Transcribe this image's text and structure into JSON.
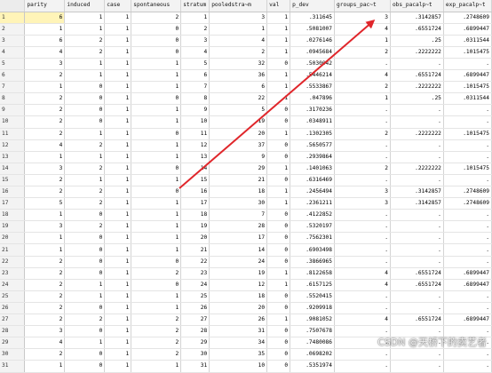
{
  "columns": [
    "",
    "parity",
    "induced",
    "case",
    "spontaneous",
    "stratum",
    "pooledstra~m",
    "val",
    "p_dev",
    "groups_pac~t",
    "obs_pacalp~t",
    "exp_pacalp~t"
  ],
  "rows": [
    [
      "1",
      "6",
      "1",
      "1",
      "2",
      "1",
      "3",
      "1",
      ".311645",
      "3",
      ".3142857",
      ".2748609"
    ],
    [
      "2",
      "1",
      "1",
      "1",
      "0",
      "2",
      "1",
      "1",
      ".5081007",
      "4",
      ".6551724",
      ".6899447"
    ],
    [
      "3",
      "6",
      "2",
      "1",
      "0",
      "3",
      "4",
      "1",
      ".0276146",
      "1",
      ".25",
      ".0311544"
    ],
    [
      "4",
      "4",
      "2",
      "1",
      "0",
      "4",
      "2",
      "1",
      ".0945684",
      "2",
      ".2222222",
      ".1015475"
    ],
    [
      "5",
      "3",
      "1",
      "1",
      "1",
      "5",
      "32",
      "0",
      ".5030042",
      ".",
      ".",
      "."
    ],
    [
      "6",
      "2",
      "1",
      "1",
      "1",
      "6",
      "36",
      "1",
      ".5446214",
      "4",
      ".6551724",
      ".6899447"
    ],
    [
      "7",
      "1",
      "0",
      "1",
      "1",
      "7",
      "6",
      "1",
      ".5533867",
      "2",
      ".2222222",
      ".1015475"
    ],
    [
      "8",
      "2",
      "0",
      "1",
      "0",
      "8",
      "22",
      "1",
      ".047896",
      "1",
      ".25",
      ".0311544"
    ],
    [
      "9",
      "2",
      "0",
      "1",
      "1",
      "9",
      "5",
      "0",
      ".3170236",
      ".",
      ".",
      "."
    ],
    [
      "10",
      "2",
      "0",
      "1",
      "1",
      "10",
      "19",
      "0",
      ".0348911",
      ".",
      ".",
      "."
    ],
    [
      "11",
      "2",
      "1",
      "1",
      "0",
      "11",
      "20",
      "1",
      ".1302305",
      "2",
      ".2222222",
      ".1015475"
    ],
    [
      "12",
      "4",
      "2",
      "1",
      "1",
      "12",
      "37",
      "0",
      ".5650577",
      ".",
      ".",
      "."
    ],
    [
      "13",
      "1",
      "1",
      "1",
      "1",
      "13",
      "9",
      "0",
      ".2939864",
      ".",
      ".",
      "."
    ],
    [
      "14",
      "3",
      "2",
      "1",
      "0",
      "14",
      "29",
      "1",
      ".1401063",
      "2",
      ".2222222",
      ".1015475"
    ],
    [
      "15",
      "2",
      "1",
      "1",
      "1",
      "15",
      "21",
      "0",
      ".6316469",
      ".",
      ".",
      "."
    ],
    [
      "16",
      "2",
      "2",
      "1",
      "0",
      "16",
      "18",
      "1",
      ".2456494",
      "3",
      ".3142857",
      ".2748609"
    ],
    [
      "17",
      "5",
      "2",
      "1",
      "1",
      "17",
      "30",
      "1",
      ".2361211",
      "3",
      ".3142857",
      ".2748609"
    ],
    [
      "18",
      "1",
      "0",
      "1",
      "1",
      "18",
      "7",
      "0",
      ".4122852",
      ".",
      ".",
      "."
    ],
    [
      "19",
      "3",
      "2",
      "1",
      "1",
      "19",
      "28",
      "0",
      ".5320197",
      ".",
      ".",
      "."
    ],
    [
      "20",
      "1",
      "0",
      "1",
      "1",
      "20",
      "17",
      "0",
      ".7562301",
      ".",
      ".",
      "."
    ],
    [
      "21",
      "1",
      "0",
      "1",
      "1",
      "21",
      "14",
      "0",
      ".6903498",
      ".",
      ".",
      "."
    ],
    [
      "22",
      "2",
      "0",
      "1",
      "0",
      "22",
      "24",
      "0",
      ".3866965",
      ".",
      ".",
      "."
    ],
    [
      "23",
      "2",
      "0",
      "1",
      "2",
      "23",
      "19",
      "1",
      ".8122658",
      "4",
      ".6551724",
      ".6899447"
    ],
    [
      "24",
      "2",
      "1",
      "1",
      "0",
      "24",
      "12",
      "1",
      ".6157125",
      "4",
      ".6551724",
      ".6899447"
    ],
    [
      "25",
      "2",
      "1",
      "1",
      "1",
      "25",
      "18",
      "0",
      ".5520415",
      ".",
      ".",
      "."
    ],
    [
      "26",
      "2",
      "0",
      "1",
      "1",
      "26",
      "20",
      "0",
      ".9209918",
      ".",
      ".",
      "."
    ],
    [
      "27",
      "2",
      "2",
      "1",
      "2",
      "27",
      "26",
      "1",
      ".9081052",
      "4",
      ".6551724",
      ".6899447"
    ],
    [
      "28",
      "3",
      "0",
      "1",
      "2",
      "28",
      "31",
      "0",
      ".7507678",
      ".",
      ".",
      "."
    ],
    [
      "29",
      "4",
      "1",
      "1",
      "2",
      "29",
      "34",
      "0",
      ".7480086",
      ".",
      ".",
      "."
    ],
    [
      "30",
      "2",
      "0",
      "1",
      "2",
      "30",
      "35",
      "0",
      ".0698202",
      ".",
      ".",
      "."
    ],
    [
      "31",
      "1",
      "0",
      "1",
      "1",
      "31",
      "10",
      "0",
      ".5351974",
      ".",
      ".",
      "."
    ]
  ],
  "selected_row": "1",
  "annotation": {
    "type": "arrow",
    "color": "#e0262b"
  },
  "watermark": "CSDN @天桥下的卖艺者"
}
